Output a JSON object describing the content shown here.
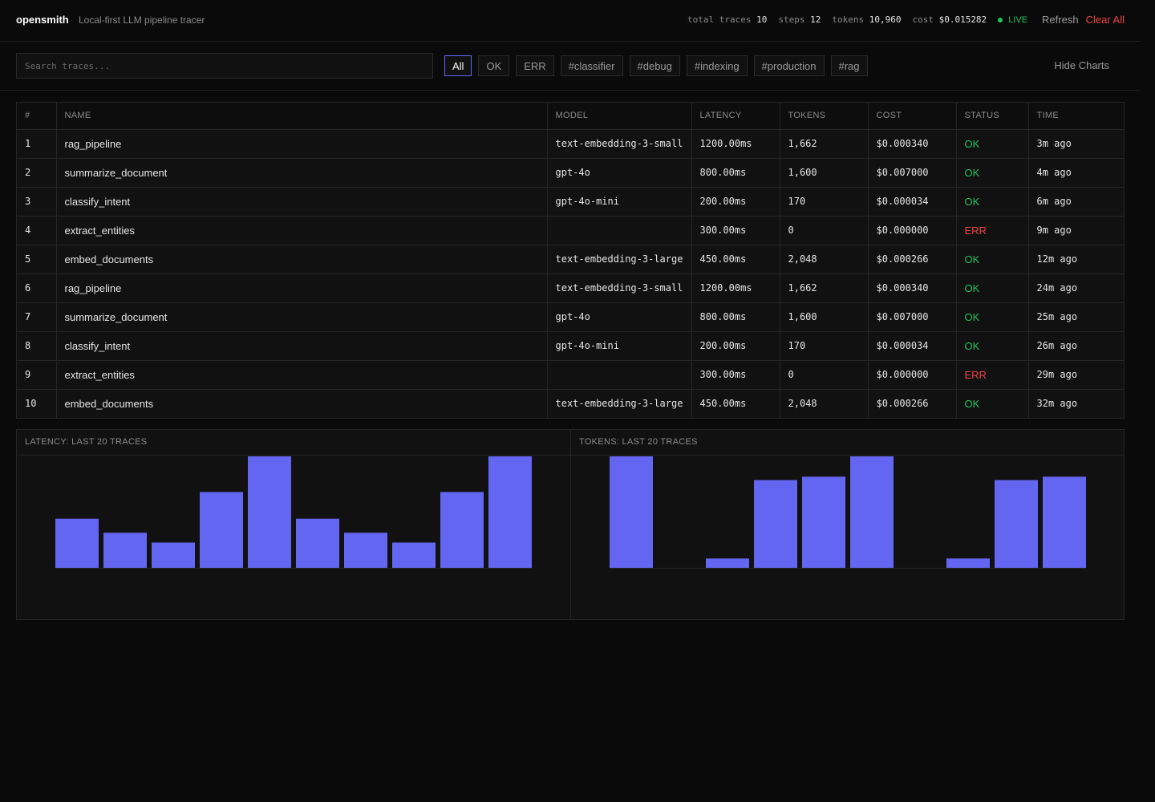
{
  "header": {
    "brand": "opensmith",
    "tagline": "Local-first LLM pipeline tracer",
    "stats": [
      {
        "label": "total traces",
        "value": "10"
      },
      {
        "label": "steps",
        "value": "12"
      },
      {
        "label": "tokens",
        "value": "10,960"
      },
      {
        "label": "cost",
        "value": "$0.015282"
      }
    ],
    "live": "LIVE",
    "refresh": "Refresh",
    "clear_all": "Clear All"
  },
  "toolbar": {
    "search_placeholder": "Search traces...",
    "filters": [
      "All",
      "OK",
      "ERR",
      "#classifier",
      "#debug",
      "#indexing",
      "#production",
      "#rag"
    ],
    "active_filter": "All",
    "hide_charts": "Hide Charts"
  },
  "table": {
    "columns": [
      "#",
      "NAME",
      "MODEL",
      "LATENCY",
      "TOKENS",
      "COST",
      "STATUS",
      "TIME"
    ],
    "rows": [
      {
        "id": "1",
        "name": "rag_pipeline",
        "model": "text-embedding-3-small",
        "latency": "1200.00ms",
        "tokens": "1,662",
        "cost": "$0.000340",
        "status": "OK",
        "time": "3m ago"
      },
      {
        "id": "2",
        "name": "summarize_document",
        "model": "gpt-4o",
        "latency": "800.00ms",
        "tokens": "1,600",
        "cost": "$0.007000",
        "status": "OK",
        "time": "4m ago"
      },
      {
        "id": "3",
        "name": "classify_intent",
        "model": "gpt-4o-mini",
        "latency": "200.00ms",
        "tokens": "170",
        "cost": "$0.000034",
        "status": "OK",
        "time": "6m ago"
      },
      {
        "id": "4",
        "name": "extract_entities",
        "model": "",
        "latency": "300.00ms",
        "tokens": "0",
        "cost": "$0.000000",
        "status": "ERR",
        "time": "9m ago"
      },
      {
        "id": "5",
        "name": "embed_documents",
        "model": "text-embedding-3-large",
        "latency": "450.00ms",
        "tokens": "2,048",
        "cost": "$0.000266",
        "status": "OK",
        "time": "12m ago"
      },
      {
        "id": "6",
        "name": "rag_pipeline",
        "model": "text-embedding-3-small",
        "latency": "1200.00ms",
        "tokens": "1,662",
        "cost": "$0.000340",
        "status": "OK",
        "time": "24m ago"
      },
      {
        "id": "7",
        "name": "summarize_document",
        "model": "gpt-4o",
        "latency": "800.00ms",
        "tokens": "1,600",
        "cost": "$0.007000",
        "status": "OK",
        "time": "25m ago"
      },
      {
        "id": "8",
        "name": "classify_intent",
        "model": "gpt-4o-mini",
        "latency": "200.00ms",
        "tokens": "170",
        "cost": "$0.000034",
        "status": "OK",
        "time": "26m ago"
      },
      {
        "id": "9",
        "name": "extract_entities",
        "model": "",
        "latency": "300.00ms",
        "tokens": "0",
        "cost": "$0.000000",
        "status": "ERR",
        "time": "29m ago"
      },
      {
        "id": "10",
        "name": "embed_documents",
        "model": "text-embedding-3-large",
        "latency": "450.00ms",
        "tokens": "2,048",
        "cost": "$0.000266",
        "status": "OK",
        "time": "32m ago"
      }
    ]
  },
  "colors": {
    "accent": "#6366f1",
    "ok": "#22c55e",
    "err": "#ef4444"
  },
  "chart_data": [
    {
      "type": "bar",
      "title": "LATENCY: LAST 20 TRACES",
      "values": [
        350,
        250,
        180,
        540,
        800,
        350,
        250,
        180,
        540,
        800
      ],
      "ylim": [
        0,
        800
      ]
    },
    {
      "type": "bar",
      "title": "TOKENS: LAST 20 TRACES",
      "values": [
        2048,
        0,
        170,
        1600,
        1662,
        2048,
        0,
        170,
        1600,
        1662
      ],
      "ylim": [
        0,
        2048
      ]
    }
  ]
}
